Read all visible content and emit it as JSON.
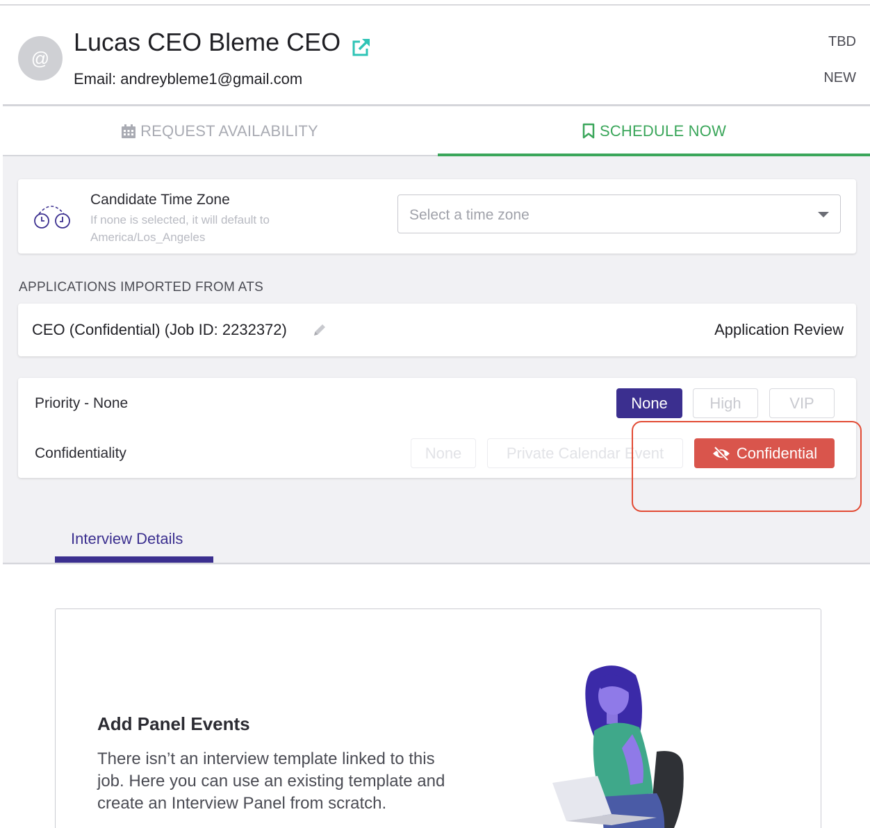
{
  "candidate": {
    "avatar_symbol": "@",
    "name": "Lucas CEO Bleme CEO",
    "email_line": "Email: andreybleme1@gmail.com",
    "status_top": "TBD",
    "status_bottom": "NEW"
  },
  "tabs": {
    "request_label": "REQUEST AVAILABILITY",
    "schedule_label": "SCHEDULE NOW",
    "active": "schedule"
  },
  "timezone": {
    "title": "Candidate Time Zone",
    "hint": "If none is selected, it will default to America/Los_Angeles",
    "placeholder": "Select a time zone"
  },
  "applications": {
    "section_label": "APPLICATIONS IMPORTED FROM ATS",
    "items": [
      {
        "title": "CEO (Confidential) (Job ID: 2232372)",
        "status": "Application Review"
      }
    ]
  },
  "priority": {
    "label": "Priority - None",
    "options": [
      "None",
      "High",
      "VIP"
    ],
    "selected": "None"
  },
  "confidentiality": {
    "label": "Confidentiality",
    "options": [
      "None",
      "Private Calendar Event",
      "Confidential"
    ],
    "selected": "Confidential"
  },
  "subtabs": {
    "interview_details": "Interview Details"
  },
  "panel": {
    "title": "Add Panel Events",
    "text": "There isn’t an interview template linked to this job. Here you can use an existing template and create an Interview Panel from scratch."
  },
  "colors": {
    "accent_green": "#3aa65a",
    "accent_purple": "#3b2f8f",
    "confidential_red": "#d9554c",
    "highlight_red": "#e24a33",
    "external_link_teal": "#2ec4b6"
  },
  "icons": {
    "external_link": "external-link-icon",
    "calendar": "calendar-icon",
    "bookmark": "bookmark-icon",
    "timezone": "timezone-clocks-icon",
    "pencil": "pencil-icon",
    "eye_slash": "eye-slash-icon",
    "dropdown": "chevron-down-icon"
  }
}
